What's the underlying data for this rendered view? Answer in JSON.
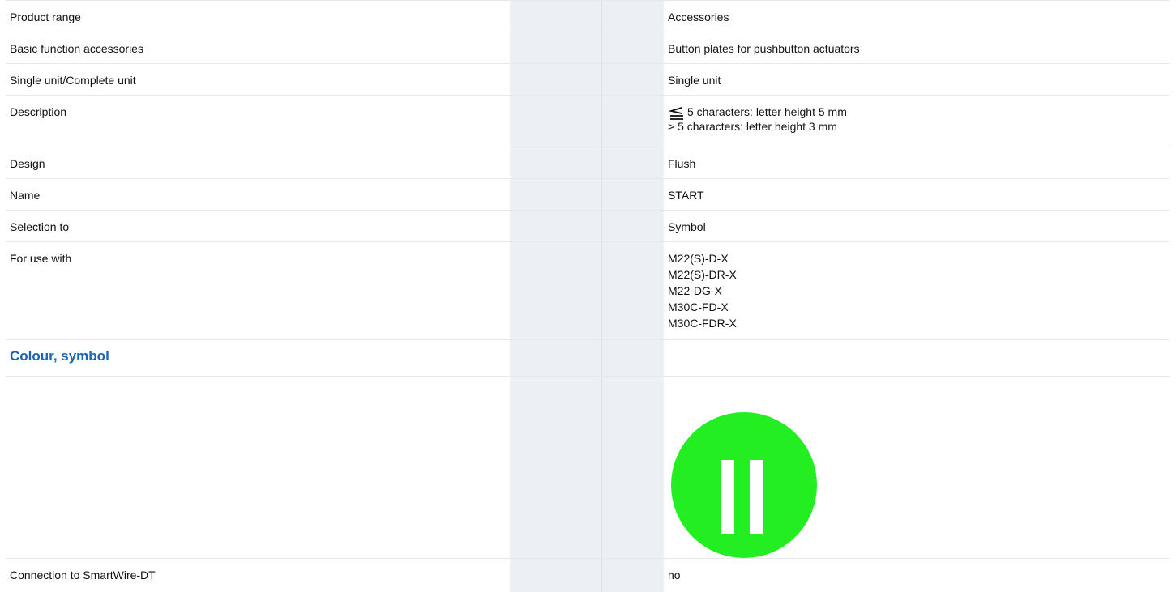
{
  "rows": {
    "product_range": {
      "label": "Product range",
      "value": "Accessories"
    },
    "basic_function": {
      "label": "Basic function accessories",
      "value": "Button plates for pushbutton actuators"
    },
    "single_unit": {
      "label": "Single unit/Complete unit",
      "value": "Single unit"
    },
    "description": {
      "label": "Description",
      "icon": "less-equal-icon",
      "line1": "5 characters: letter height 5 mm",
      "line2": "> 5 characters: letter height 3 mm"
    },
    "design": {
      "label": "Design",
      "value": "Flush"
    },
    "name": {
      "label": "Name",
      "value": "START"
    },
    "selection_to": {
      "label": "Selection to",
      "value": "Symbol"
    },
    "for_use_with": {
      "label": "For use with",
      "values": [
        "M22(S)-D-X",
        "M22(S)-DR-X",
        "M22-DG-X",
        "M30C-FD-X",
        "M30C-FDR-X"
      ]
    },
    "colour_symbol": {
      "title": "Colour, symbol",
      "plate_color": "#22ee22",
      "symbol_icon": "start-button-plate-icon"
    },
    "smartwire": {
      "label": "Connection to SmartWire-DT",
      "value": "no"
    }
  },
  "colors": {
    "section_title": "#1a63b6",
    "gray_column": "#eceff3",
    "row_divider": "#e6e8ec"
  }
}
